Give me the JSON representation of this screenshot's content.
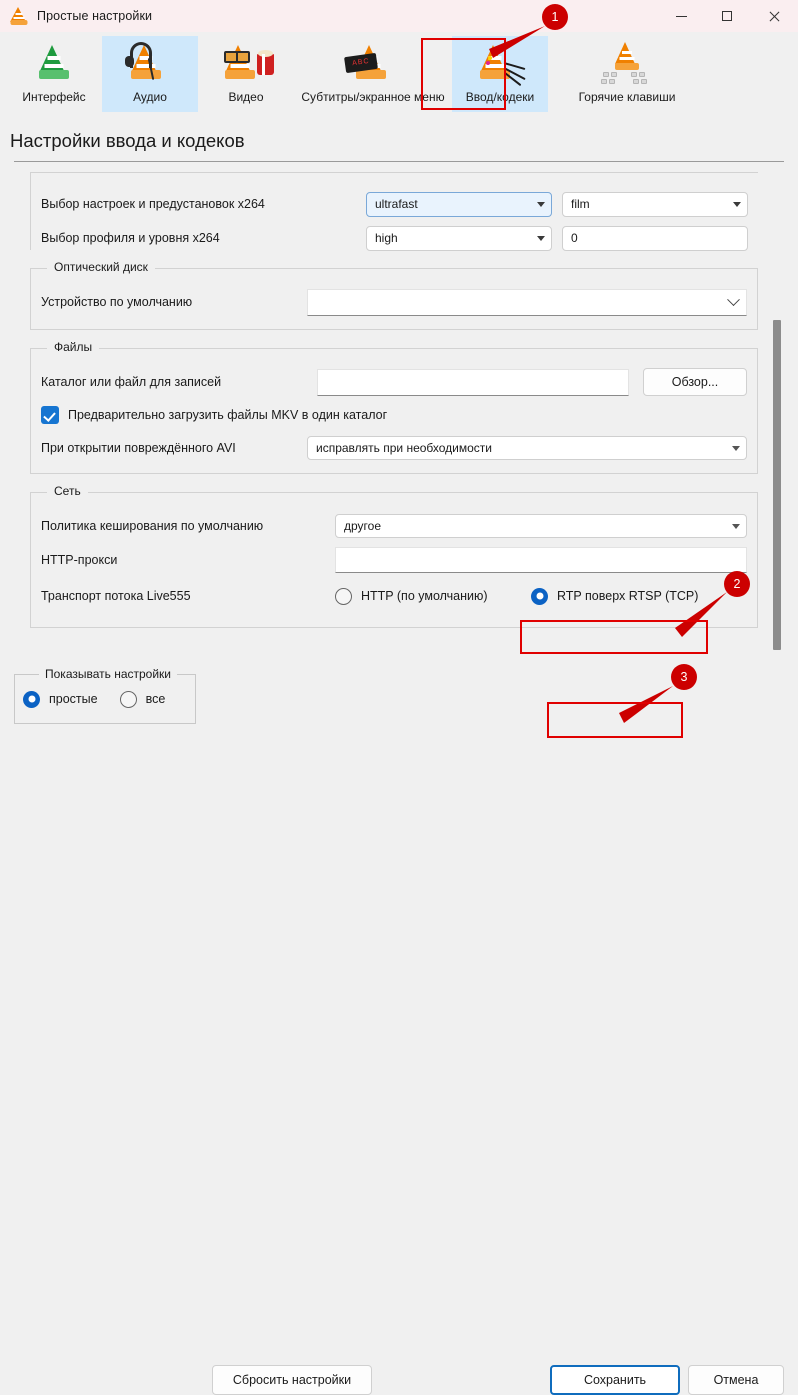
{
  "window": {
    "title": "Простые настройки",
    "icon": "vlc-cone-icon",
    "minimize": "−",
    "maximize": "□",
    "close": "×"
  },
  "toolbar": {
    "items": [
      {
        "label": "Интерфейс",
        "icon": "vlc-cone-green-icon",
        "selected": false
      },
      {
        "label": "Аудио",
        "icon": "vlc-headphones-icon",
        "selected": true
      },
      {
        "label": "Видео",
        "icon": "vlc-glasses-popcorn-icon",
        "selected": false
      },
      {
        "label": "Субтитры/экранное меню",
        "icon": "vlc-signboard-icon",
        "selected": false
      },
      {
        "label": "Ввод/кодеки",
        "icon": "vlc-cables-icon",
        "selected": false
      },
      {
        "label": "Горячие клавиши",
        "icon": "vlc-keyboard-icon",
        "selected": false
      }
    ]
  },
  "page": {
    "title": "Настройки ввода и кодеков"
  },
  "x264": {
    "preset_label": "Выбор настроек и предустановок x264",
    "preset_value": "ultrafast",
    "tune_value": "film",
    "profile_label": "Выбор профиля и уровня x264",
    "profile_value": "high",
    "level_value": "0"
  },
  "optical": {
    "legend": "Оптический диск",
    "device_label": "Устройство по умолчанию",
    "device_value": ""
  },
  "files": {
    "legend": "Файлы",
    "record_label": "Каталог или файл для записей",
    "record_value": "",
    "browse_button": "Обзор...",
    "mkv_checkbox_label": "Предварительно загрузить файлы MKV в один каталог",
    "mkv_checked": true,
    "avi_label": "При открытии повреждённого AVI",
    "avi_value": "исправлять при необходимости"
  },
  "network": {
    "legend": "Сеть",
    "caching_label": "Политика кеширования по умолчанию",
    "caching_value": "другое",
    "proxy_label": "HTTP-прокси",
    "proxy_value": "",
    "transport_label": "Транспорт потока Live555",
    "options": [
      {
        "label": "HTTP (по умолчанию)",
        "selected": false
      },
      {
        "label": "RTP поверх RTSP (TCP)",
        "selected": true
      }
    ]
  },
  "footer": {
    "show_settings_legend": "Показывать настройки",
    "show_options": [
      {
        "label": "простые",
        "selected": true
      },
      {
        "label": "все",
        "selected": false
      }
    ],
    "reset_button": "Сбросить настройки",
    "save_button": "Сохранить",
    "cancel_button": "Отмена"
  },
  "annotations": {
    "accent_color": "#cc0000",
    "badges": [
      {
        "number": "1"
      },
      {
        "number": "2"
      },
      {
        "number": "3"
      }
    ]
  }
}
